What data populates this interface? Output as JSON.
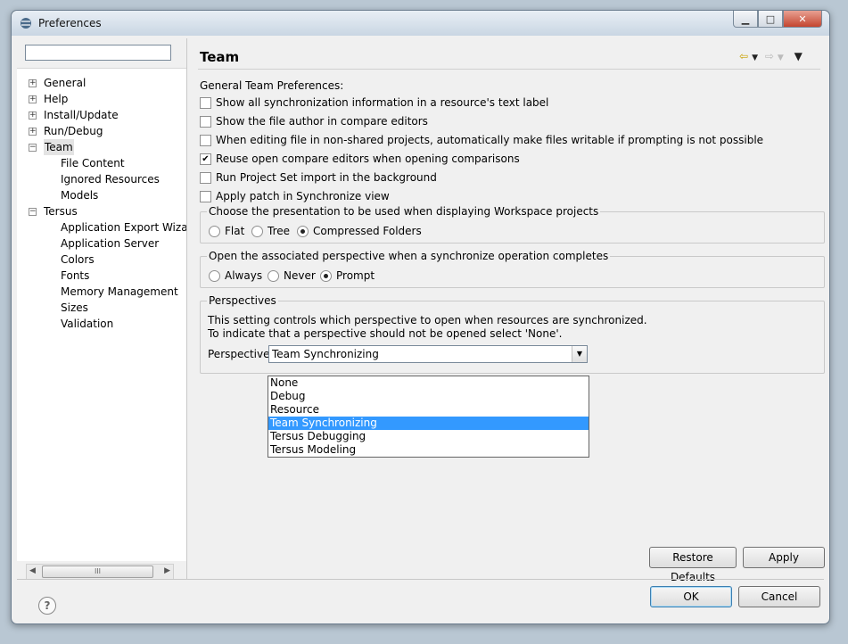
{
  "window": {
    "title": "Preferences"
  },
  "tree": {
    "items": [
      {
        "label": "General",
        "toggle": "+"
      },
      {
        "label": "Help",
        "toggle": "+"
      },
      {
        "label": "Install/Update",
        "toggle": "+"
      },
      {
        "label": "Run/Debug",
        "toggle": "+"
      },
      {
        "label": "Team",
        "toggle": "−"
      },
      {
        "label": "File Content"
      },
      {
        "label": "Ignored Resources"
      },
      {
        "label": "Models"
      },
      {
        "label": "Tersus",
        "toggle": "−"
      },
      {
        "label": "Application Export Wiza"
      },
      {
        "label": "Application Server"
      },
      {
        "label": "Colors"
      },
      {
        "label": "Fonts"
      },
      {
        "label": "Memory Management"
      },
      {
        "label": "Sizes"
      },
      {
        "label": "Validation"
      }
    ],
    "scroll_thumb": "III"
  },
  "page": {
    "title": "Team",
    "section_label": "General Team Preferences:",
    "checkboxes": [
      {
        "label": "Show all synchronization information in a resource's text label",
        "checked": false
      },
      {
        "label": "Show the file author in compare editors",
        "checked": false
      },
      {
        "label": "When editing file in non-shared projects, automatically make files writable if prompting is not possible",
        "checked": false
      },
      {
        "label": "Reuse open compare editors when opening comparisons",
        "checked": true
      },
      {
        "label": "Run Project Set import in the background",
        "checked": false
      },
      {
        "label": "Apply patch in Synchronize view",
        "checked": false
      }
    ],
    "presentation_group": {
      "legend": "Choose the presentation to be used when displaying Workspace projects",
      "options": [
        "Flat",
        "Tree",
        "Compressed Folders"
      ],
      "selected": "Compressed Folders"
    },
    "perspective_open_group": {
      "legend": "Open the associated perspective when a synchronize operation completes",
      "options": [
        "Always",
        "Never",
        "Prompt"
      ],
      "selected": "Prompt"
    },
    "perspectives_group": {
      "legend": "Perspectives",
      "desc1": "This setting controls which perspective to open when resources are synchronized.",
      "desc2": "To indicate that a perspective should not be opened select 'None'.",
      "label": "Perspective:",
      "value": "Team Synchronizing",
      "options": [
        "None",
        "Debug",
        "Resource",
        "Team Synchronizing",
        "Tersus Debugging",
        "Tersus Modeling"
      ]
    },
    "restore_defaults": "Restore Defaults",
    "apply": "Apply"
  },
  "footer": {
    "help": "?",
    "ok": "OK",
    "cancel": "Cancel"
  }
}
